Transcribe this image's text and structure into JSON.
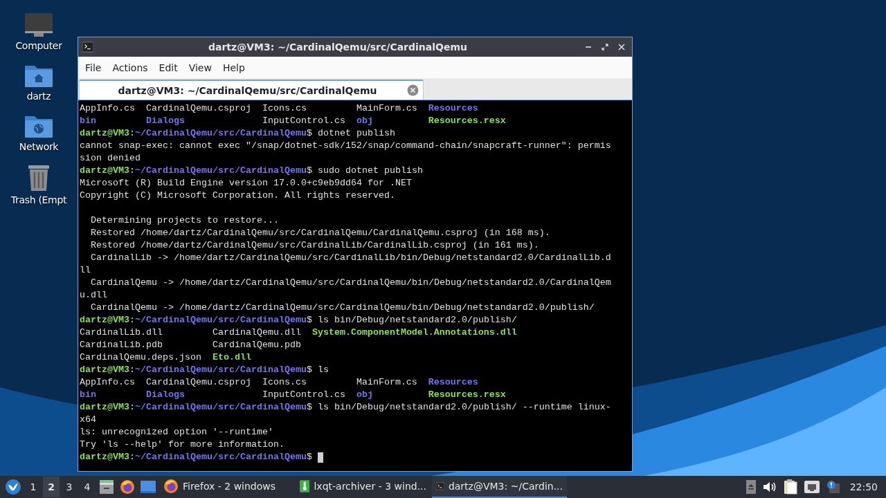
{
  "desktop_icons": [
    {
      "label": "Computer",
      "kind": "computer"
    },
    {
      "label": "dartz",
      "kind": "home"
    },
    {
      "label": "Network",
      "kind": "network"
    },
    {
      "label": "Trash (Empt",
      "kind": "trash"
    }
  ],
  "window": {
    "title": "dartz@VM3: ~/CardinalQemu/src/CardinalQemu",
    "menu": [
      "File",
      "Actions",
      "Edit",
      "View",
      "Help"
    ],
    "tabs": [
      {
        "label": "dartz@VM3: ~/CardinalQemu/src/CardinalQemu",
        "selected": true
      }
    ],
    "terminal": {
      "lines": [
        {
          "kind": "listing",
          "rows": [
            [
              {
                "text": "AppInfo.cs",
                "kind": "file"
              },
              {
                "text": "CardinalQemu.csproj",
                "kind": "file"
              },
              {
                "text": "Icons.cs",
                "kind": "file"
              },
              {
                "text": "MainForm.cs",
                "kind": "file"
              },
              {
                "text": "Resources",
                "kind": "dir"
              }
            ],
            [
              {
                "text": "bin",
                "kind": "dir"
              },
              {
                "text": "Dialogs",
                "kind": "dir"
              },
              {
                "text": "InputControl.cs",
                "kind": "file"
              },
              {
                "text": "obj",
                "kind": "dir"
              },
              {
                "text": "Resources.resx",
                "kind": "exec"
              }
            ]
          ]
        },
        {
          "kind": "text",
          "segments": [
            {
              "text": "dartz@VM3",
              "kind": "user"
            },
            {
              "text": ":",
              "kind": "plain"
            },
            {
              "text": "~/CardinalQemu/src/CardinalQemu",
              "kind": "path"
            },
            {
              "text": "$ dotnet publish",
              "kind": "plain"
            }
          ]
        },
        {
          "kind": "text",
          "segments": [
            {
              "text": "cannot snap-exec: cannot exec \"/snap/dotnet-sdk/152/snap/command-chain/snapcraft-runner\": permis",
              "kind": "plain"
            }
          ]
        },
        {
          "kind": "text",
          "segments": [
            {
              "text": "sion denied",
              "kind": "plain"
            }
          ]
        },
        {
          "kind": "text",
          "segments": [
            {
              "text": "dartz@VM3",
              "kind": "user"
            },
            {
              "text": ":",
              "kind": "plain"
            },
            {
              "text": "~/CardinalQemu/src/CardinalQemu",
              "kind": "path"
            },
            {
              "text": "$ sudo dotnet publish",
              "kind": "plain"
            }
          ]
        },
        {
          "kind": "text",
          "segments": [
            {
              "text": "Microsoft (R) Build Engine version 17.0.0+c9eb9dd64 for .NET",
              "kind": "plain"
            }
          ]
        },
        {
          "kind": "text",
          "segments": [
            {
              "text": "Copyright (C) Microsoft Corporation. All rights reserved.",
              "kind": "plain"
            }
          ]
        },
        {
          "kind": "blank"
        },
        {
          "kind": "text",
          "segments": [
            {
              "text": "  Determining projects to restore...",
              "kind": "plain"
            }
          ]
        },
        {
          "kind": "text",
          "segments": [
            {
              "text": "  Restored /home/dartz/CardinalQemu/src/CardinalQemu/CardinalQemu.csproj (in 168 ms).",
              "kind": "plain"
            }
          ]
        },
        {
          "kind": "text",
          "segments": [
            {
              "text": "  Restored /home/dartz/CardinalQemu/src/CardinalLib/CardinalLib.csproj (in 161 ms).",
              "kind": "plain"
            }
          ]
        },
        {
          "kind": "text",
          "segments": [
            {
              "text": "  CardinalLib -> /home/dartz/CardinalQemu/src/CardinalLib/bin/Debug/netstandard2.0/CardinalLib.d",
              "kind": "plain"
            }
          ]
        },
        {
          "kind": "text",
          "segments": [
            {
              "text": "ll",
              "kind": "plain"
            }
          ]
        },
        {
          "kind": "text",
          "segments": [
            {
              "text": "  CardinalQemu -> /home/dartz/CardinalQemu/src/CardinalQemu/bin/Debug/netstandard2.0/CardinalQem",
              "kind": "plain"
            }
          ]
        },
        {
          "kind": "text",
          "segments": [
            {
              "text": "u.dll",
              "kind": "plain"
            }
          ]
        },
        {
          "kind": "text",
          "segments": [
            {
              "text": "  CardinalQemu -> /home/dartz/CardinalQemu/src/CardinalQemu/bin/Debug/netstandard2.0/publish/",
              "kind": "plain"
            }
          ]
        },
        {
          "kind": "text",
          "segments": [
            {
              "text": "dartz@VM3",
              "kind": "user"
            },
            {
              "text": ":",
              "kind": "plain"
            },
            {
              "text": "~/CardinalQemu/src/CardinalQemu",
              "kind": "path"
            },
            {
              "text": "$ ls bin/Debug/netstandard2.0/publish/",
              "kind": "plain"
            }
          ]
        },
        {
          "kind": "listing",
          "rows": [
            [
              {
                "text": "CardinalLib.dll",
                "kind": "file"
              },
              {
                "text": "CardinalQemu.dll",
                "kind": "file"
              },
              {
                "text": "System.ComponentModel.Annotations.dll",
                "kind": "exec"
              }
            ],
            [
              {
                "text": "CardinalLib.pdb",
                "kind": "file"
              },
              {
                "text": "CardinalQemu.pdb",
                "kind": "file"
              }
            ],
            [
              {
                "text": "CardinalQemu.deps.json",
                "kind": "file"
              },
              {
                "text": "Eto.dll",
                "kind": "exec"
              }
            ]
          ]
        },
        {
          "kind": "text",
          "segments": [
            {
              "text": "dartz@VM3",
              "kind": "user"
            },
            {
              "text": ":",
              "kind": "plain"
            },
            {
              "text": "~/CardinalQemu/src/CardinalQemu",
              "kind": "path"
            },
            {
              "text": "$ ls",
              "kind": "plain"
            }
          ]
        },
        {
          "kind": "listing",
          "rows": [
            [
              {
                "text": "AppInfo.cs",
                "kind": "file"
              },
              {
                "text": "CardinalQemu.csproj",
                "kind": "file"
              },
              {
                "text": "Icons.cs",
                "kind": "file"
              },
              {
                "text": "MainForm.cs",
                "kind": "file"
              },
              {
                "text": "Resources",
                "kind": "dir"
              }
            ],
            [
              {
                "text": "bin",
                "kind": "dir"
              },
              {
                "text": "Dialogs",
                "kind": "dir"
              },
              {
                "text": "InputControl.cs",
                "kind": "file"
              },
              {
                "text": "obj",
                "kind": "dir"
              },
              {
                "text": "Resources.resx",
                "kind": "exec"
              }
            ]
          ]
        },
        {
          "kind": "text",
          "segments": [
            {
              "text": "dartz@VM3",
              "kind": "user"
            },
            {
              "text": ":",
              "kind": "plain"
            },
            {
              "text": "~/CardinalQemu/src/CardinalQemu",
              "kind": "path"
            },
            {
              "text": "$ ls bin/Debug/netstandard2.0/publish/ --runtime linux-",
              "kind": "plain"
            }
          ]
        },
        {
          "kind": "text",
          "segments": [
            {
              "text": "x64",
              "kind": "plain"
            }
          ]
        },
        {
          "kind": "text",
          "segments": [
            {
              "text": "ls: unrecognized option '--runtime'",
              "kind": "plain"
            }
          ]
        },
        {
          "kind": "text",
          "segments": [
            {
              "text": "Try 'ls --help' for more information.",
              "kind": "plain"
            }
          ]
        },
        {
          "kind": "text",
          "cursor": true,
          "segments": [
            {
              "text": "dartz@VM3",
              "kind": "user"
            },
            {
              "text": ":",
              "kind": "plain"
            },
            {
              "text": "~/CardinalQemu/src/CardinalQemu",
              "kind": "path"
            },
            {
              "text": "$",
              "kind": "plain"
            }
          ]
        }
      ]
    }
  },
  "taskbar": {
    "workspaces": [
      {
        "label": "1",
        "selected": false
      },
      {
        "label": "2",
        "selected": true
      },
      {
        "label": "3",
        "selected": false
      },
      {
        "label": "4",
        "selected": false
      }
    ],
    "launchers": [
      {
        "kind": "files"
      },
      {
        "kind": "firefox"
      },
      {
        "kind": "desktop"
      }
    ],
    "tasks": [
      {
        "label": "Firefox - 2 windows",
        "kind": "firefox",
        "selected": false
      },
      {
        "label": "lxqt-archiver - 3 wind...",
        "kind": "archiver",
        "selected": false
      },
      {
        "label": "dartz@VM3: ~/Cardin...",
        "kind": "terminal",
        "selected": true
      }
    ],
    "clock": "22:50"
  }
}
